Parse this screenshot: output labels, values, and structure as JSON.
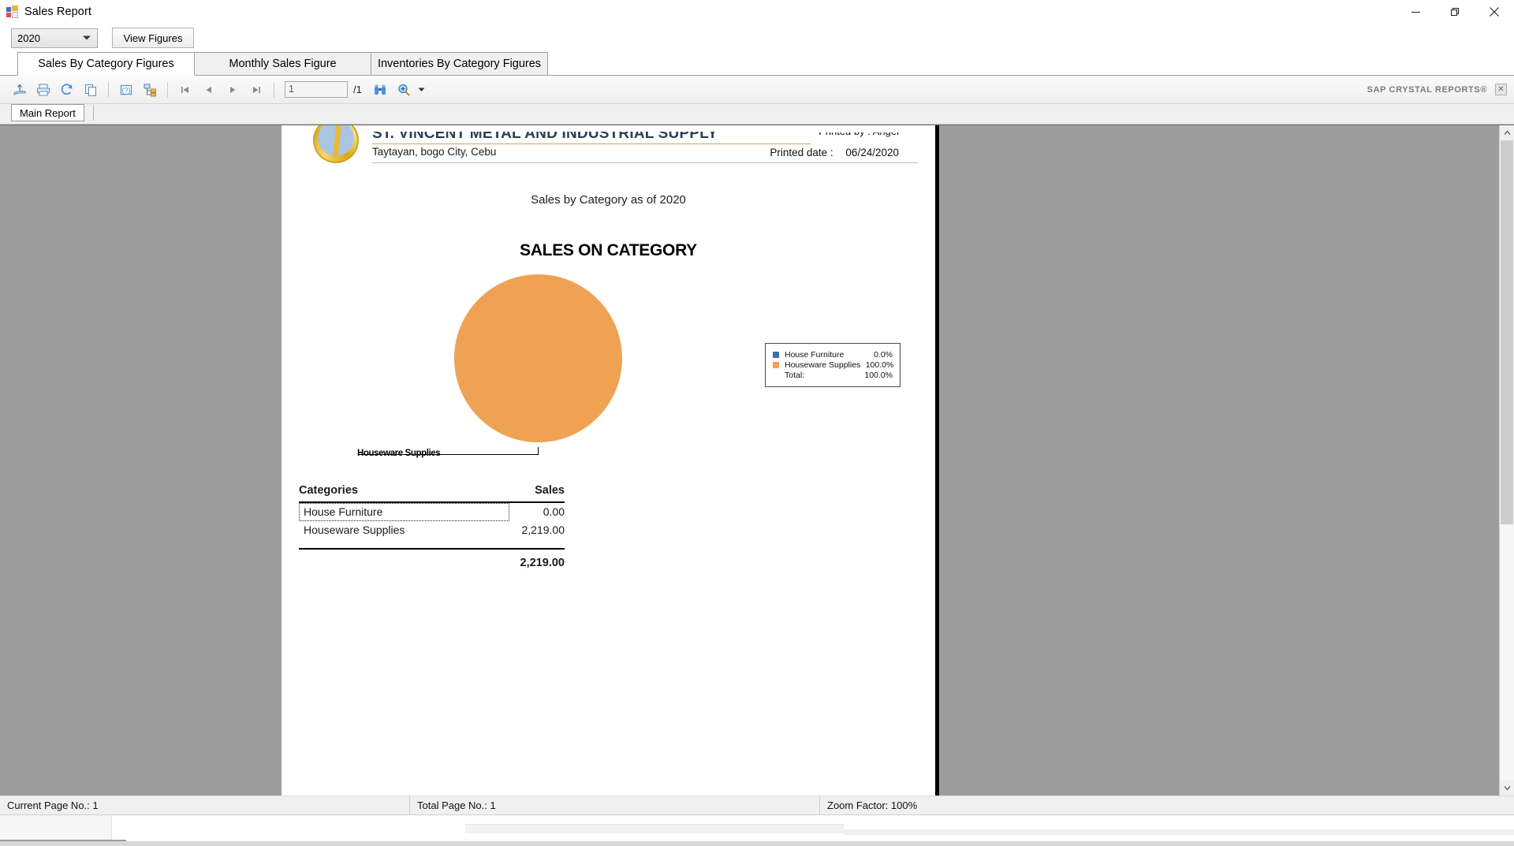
{
  "window": {
    "title": "Sales Report",
    "icon": "app-form-icon",
    "controls": {
      "minimize": "—",
      "restore": "❐",
      "close": "✕"
    }
  },
  "filter": {
    "year_value": "2020",
    "year_options": [
      "2020"
    ],
    "view_button": "View Figures"
  },
  "tabs": [
    {
      "label": "Sales By Category Figures",
      "active": true
    },
    {
      "label": "Monthly Sales Figure",
      "active": false
    },
    {
      "label": "Inventories By Category Figures",
      "active": false
    }
  ],
  "crystal_toolbar": {
    "buttons": [
      "export-report-icon",
      "print-report-icon",
      "refresh-icon",
      "copy-icon",
      "toggle-parameter-panel-icon",
      "toggle-group-tree-icon"
    ],
    "nav": {
      "first": "first-page-icon",
      "prev": "previous-page-icon",
      "next": "next-page-icon",
      "last": "last-page-icon"
    },
    "page_number": "1",
    "page_total": "/1",
    "find_icon": "binoculars-find-icon",
    "zoom_icon": "zoom-magnifier-icon",
    "zoom_dropdown": "chevron-down-icon",
    "brand": "SAP CRYSTAL REPORTS®",
    "close_label": "✕"
  },
  "report_tab": {
    "label": "Main Report"
  },
  "report": {
    "logo": "company-emblem-logo",
    "company": "ST. VINCENT METAL AND INDUSTRIAL SUPPLY",
    "address": "Taytayan, bogo City, Cebu",
    "printed_by_label": "Printed by :",
    "printed_by_value": "Angel",
    "printed_date_label": "Printed date :",
    "printed_date_value": "06/24/2020",
    "subtitle": "Sales by Category as of 2020",
    "chart_title": "SALES ON CATEGORY",
    "pie_callout": "Houseware Supplies",
    "legend": {
      "rows": [
        {
          "name": "House Furniture",
          "value": "0.0%",
          "color": "#3b6fb0"
        },
        {
          "name": "Houseware Supplies",
          "value": "100.0%",
          "color": "#efa254"
        }
      ],
      "total_label": "Total:",
      "total_value": "100.0%"
    },
    "table": {
      "headers": {
        "category": "Categories",
        "sales": "Sales"
      },
      "rows": [
        {
          "category": "House Furniture",
          "sales": "0.00",
          "selected": true
        },
        {
          "category": "Houseware Supplies",
          "sales": "2,219.00",
          "selected": false
        }
      ],
      "total": "2,219.00"
    }
  },
  "chart_data": {
    "type": "pie",
    "title": "SALES ON CATEGORY",
    "subtitle": "Sales by Category as of 2020",
    "categories": [
      "House Furniture",
      "Houseware Supplies"
    ],
    "values": [
      0.0,
      2219.0
    ],
    "percentages": [
      0.0,
      100.0
    ],
    "colors": [
      "#3b6fb0",
      "#efa254"
    ],
    "total": 2219.0,
    "total_percent": 100.0,
    "legend_position": "right",
    "labels_shown": [
      "Houseware Supplies"
    ],
    "grid": false
  },
  "statusbar": {
    "current_page": "Current Page No.: 1",
    "total_page": "Total Page No.: 1",
    "zoom_factor": "Zoom Factor: 100%"
  }
}
